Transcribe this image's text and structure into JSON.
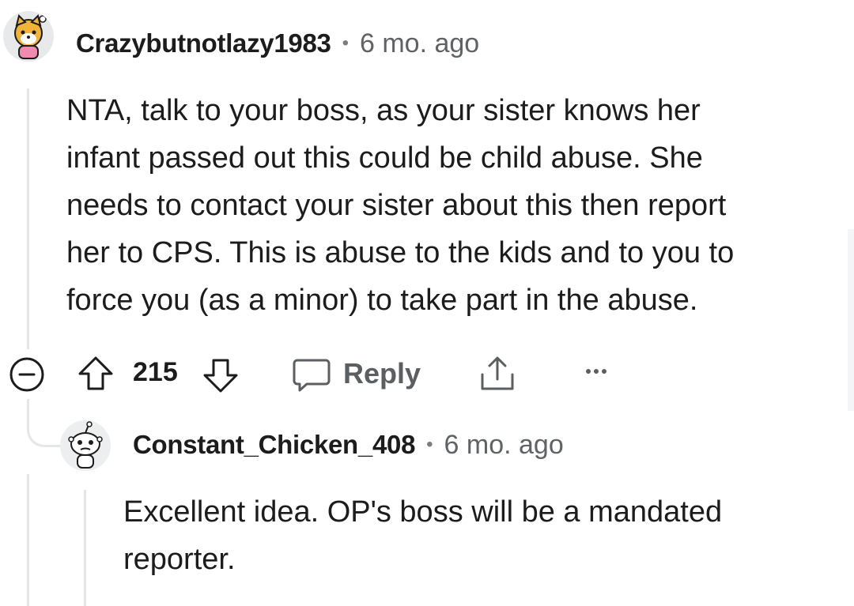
{
  "comment": {
    "username": "Crazybutnotlazy1983",
    "separator": "•",
    "time": "6 mo. ago",
    "body_lines": [
      "NTA, talk to your boss, as your sister knows her",
      "infant passed out this could be child abuse. She",
      "needs to contact your sister about this then report",
      "her to CPS. This is abuse to the kids and to you to",
      "force you (as a minor) to take part in the abuse."
    ],
    "score": "215",
    "reply_label": "Reply",
    "collapse_icon": "collapse-minus-icon",
    "more_icon": "more-dots-icon"
  },
  "reply": {
    "username": "Constant_Chicken_408",
    "separator": "•",
    "time": "6 mo. ago",
    "body_lines": [
      "Excellent idea. OP's boss will be a mandated",
      "reporter."
    ]
  },
  "colors": {
    "text": "#1c1c1c",
    "meta": "#5f6366",
    "thread_line": "#e4e6e8",
    "action_icon": "#1c1c1c"
  }
}
